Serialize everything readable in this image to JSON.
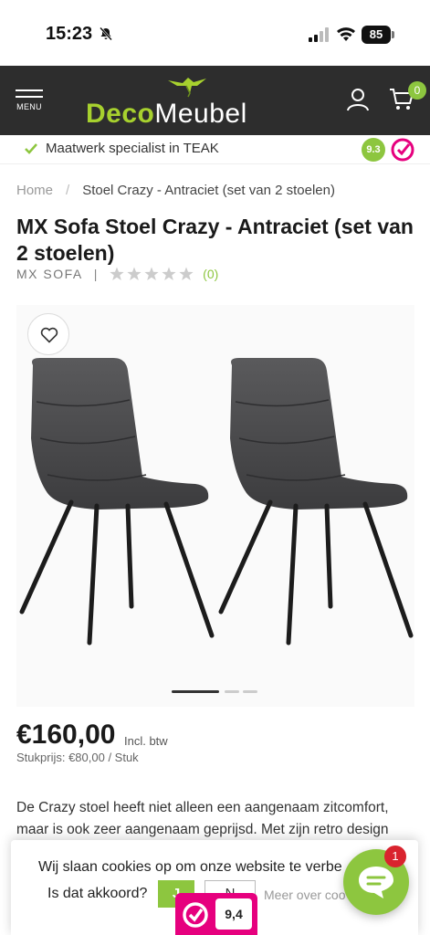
{
  "status_bar": {
    "time": "15:23",
    "battery": "85"
  },
  "header": {
    "menu_label": "MENU",
    "logo": {
      "part1": "Deco",
      "part2": "Meubel"
    },
    "cart_count": "0"
  },
  "usp": {
    "text": "Maatwerk specialist in TEAK",
    "score": "9.3"
  },
  "breadcrumb": {
    "home": "Home",
    "separator": "/",
    "current": "Stoel Crazy - Antraciet (set van 2 stoelen)"
  },
  "product": {
    "title": "MX Sofa Stoel Crazy - Antraciet (set van 2 stoelen)",
    "brand": "MX SOFA",
    "rating": 0,
    "review_count": "(0)",
    "price": "€160,00",
    "price_note": "Incl. btw",
    "unit_price": "Stukprijs: €80,00 / Stuk",
    "gallery": {
      "slides": 3,
      "active": 1
    },
    "description": "De Crazy stoel heeft niet alleen een aangenaam zitcomfort, maar is ook zeer aangenaam geprijsd. Met zijn retro design"
  },
  "cookie": {
    "text": "Wij slaan cookies op om onze website te verbe",
    "question": "Is dat akkoord?",
    "accept": "J",
    "decline": "N",
    "more": "Meer over coo"
  },
  "chat": {
    "badge": "1"
  },
  "kiyoh_widget": {
    "score": "9,4"
  },
  "colors": {
    "brand_green": "#8dc63f",
    "header_bg": "#2d2d2d",
    "kiyoh_pink": "#e6007e",
    "badge_red": "#d9232e"
  }
}
